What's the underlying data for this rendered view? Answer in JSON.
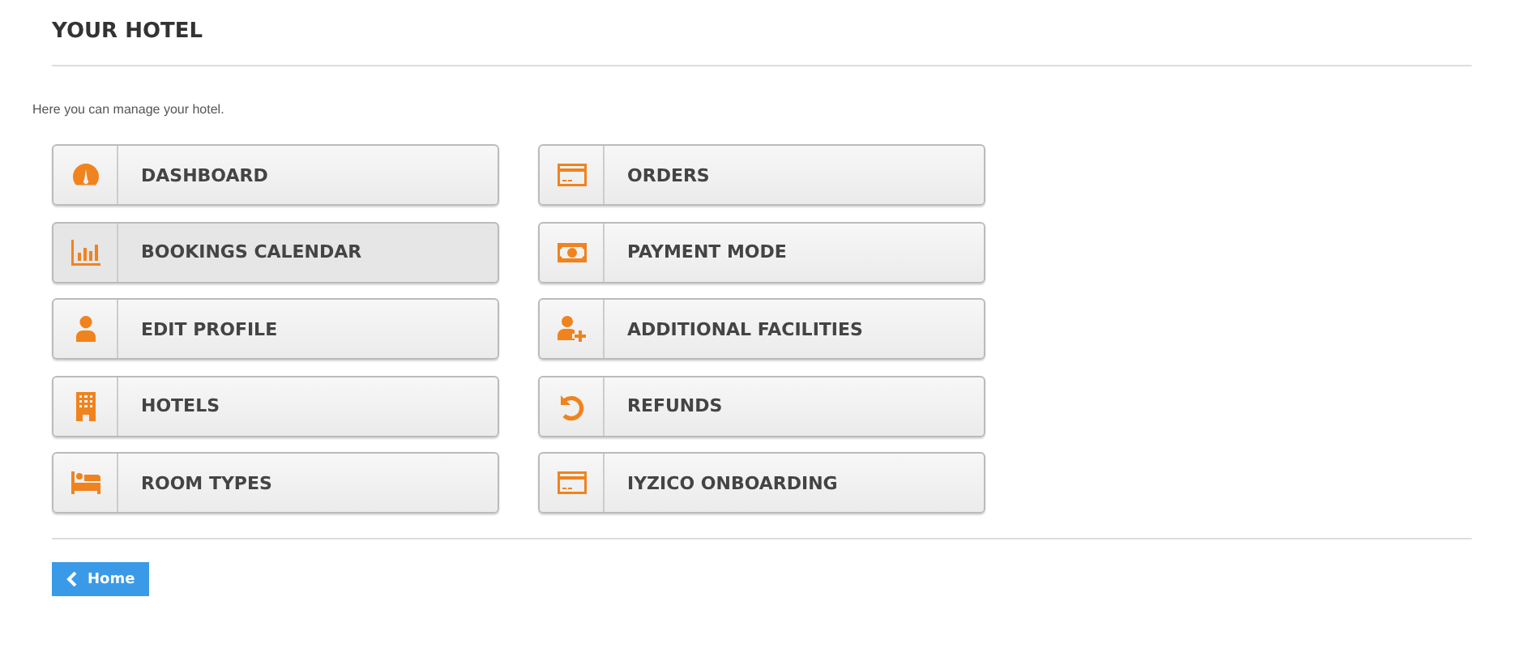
{
  "title": "YOUR HOTEL",
  "intro": "Here you can manage your hotel.",
  "tiles": [
    {
      "label": "DASHBOARD",
      "selected": false
    },
    {
      "label": "ORDERS",
      "selected": false
    },
    {
      "label": "BOOKINGS CALENDAR",
      "selected": true
    },
    {
      "label": "PAYMENT MODE",
      "selected": false
    },
    {
      "label": "EDIT PROFILE",
      "selected": false
    },
    {
      "label": "ADDITIONAL FACILITIES",
      "selected": false
    },
    {
      "label": "HOTELS",
      "selected": false
    },
    {
      "label": "REFUNDS",
      "selected": false
    },
    {
      "label": "ROOM TYPES",
      "selected": false
    },
    {
      "label": "IYZICO ONBOARDING",
      "selected": false
    }
  ],
  "back_button": "Home"
}
